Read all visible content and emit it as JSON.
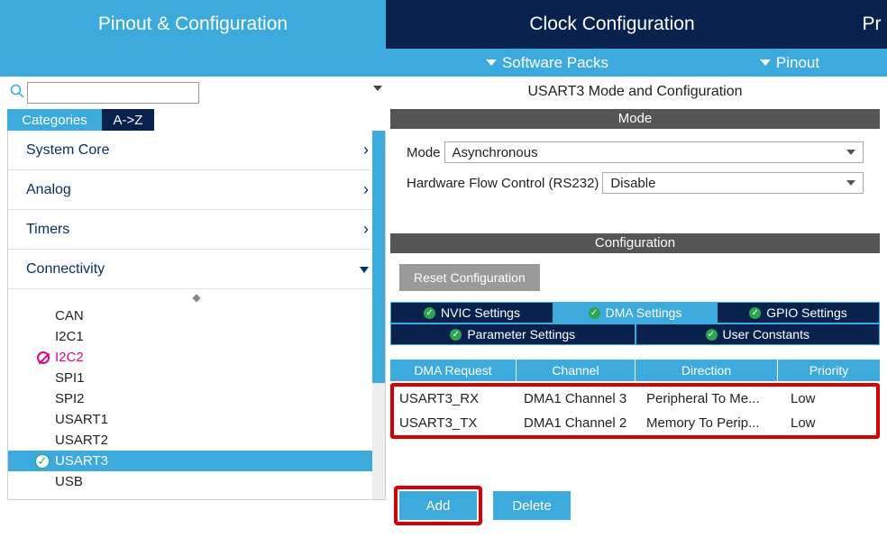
{
  "top_tabs": {
    "pinout": "Pinout & Configuration",
    "clock": "Clock Configuration",
    "pr": "Pr"
  },
  "sub_bar": {
    "software": "Software Packs",
    "pinout": "Pinout"
  },
  "left": {
    "tabs": {
      "categories": "Categories",
      "az": "A->Z"
    },
    "sections": {
      "system_core": "System Core",
      "analog": "Analog",
      "timers": "Timers",
      "connectivity": "Connectivity"
    },
    "conn_items": [
      "CAN",
      "I2C1",
      "I2C2",
      "SPI1",
      "SPI2",
      "USART1",
      "USART2",
      "USART3",
      "USB"
    ]
  },
  "right": {
    "title": "USART3 Mode and Configuration",
    "mode_header": "Mode",
    "mode_label": "Mode",
    "mode_value": "Asynchronous",
    "hwflow_label": "Hardware Flow Control (RS232)",
    "hwflow_value": "Disable",
    "config_header": "Configuration",
    "reset_btn": "Reset Configuration",
    "cfg_tabs": {
      "nvic": "NVIC Settings",
      "dma": "DMA Settings",
      "gpio": "GPIO Settings",
      "param": "Parameter Settings",
      "user": "User Constants"
    },
    "dma": {
      "headers": [
        "DMA Request",
        "Channel",
        "Direction",
        "Priority"
      ],
      "rows": [
        {
          "req": "USART3_RX",
          "ch": "DMA1 Channel 3",
          "dir": "Peripheral To Me...",
          "pri": "Low"
        },
        {
          "req": "USART3_TX",
          "ch": "DMA1 Channel 2",
          "dir": "Memory To Perip...",
          "pri": "Low"
        }
      ]
    },
    "buttons": {
      "add": "Add",
      "delete": "Delete"
    }
  }
}
